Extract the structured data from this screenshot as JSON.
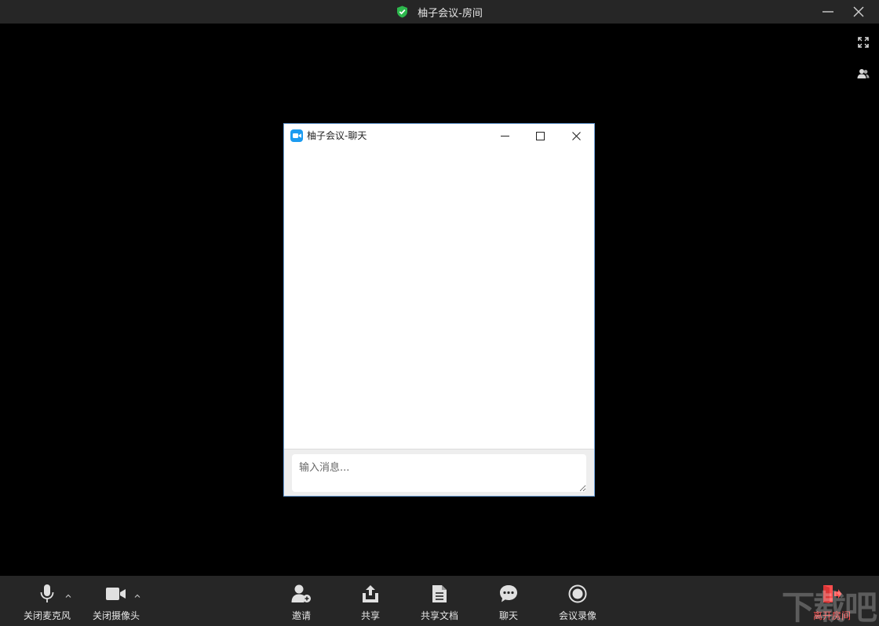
{
  "window": {
    "title": "柚子会议-房间",
    "shield_color": "#2db84d"
  },
  "side_icons": [
    "fullscreen-icon",
    "participants-icon"
  ],
  "chat": {
    "title": "柚子会议-聊天",
    "input_placeholder": "输入消息...",
    "logo_color": "#1c9bf0"
  },
  "toolbar": {
    "mic_label": "关闭麦克风",
    "camera_label": "关闭摄像头",
    "invite_label": "邀请",
    "share_label": "共享",
    "share_doc_label": "共享文档",
    "chat_label": "聊天",
    "record_label": "会议录像",
    "leave_label": "离开房间",
    "leave_color": "#ff4d4d"
  },
  "watermark": "下载吧"
}
